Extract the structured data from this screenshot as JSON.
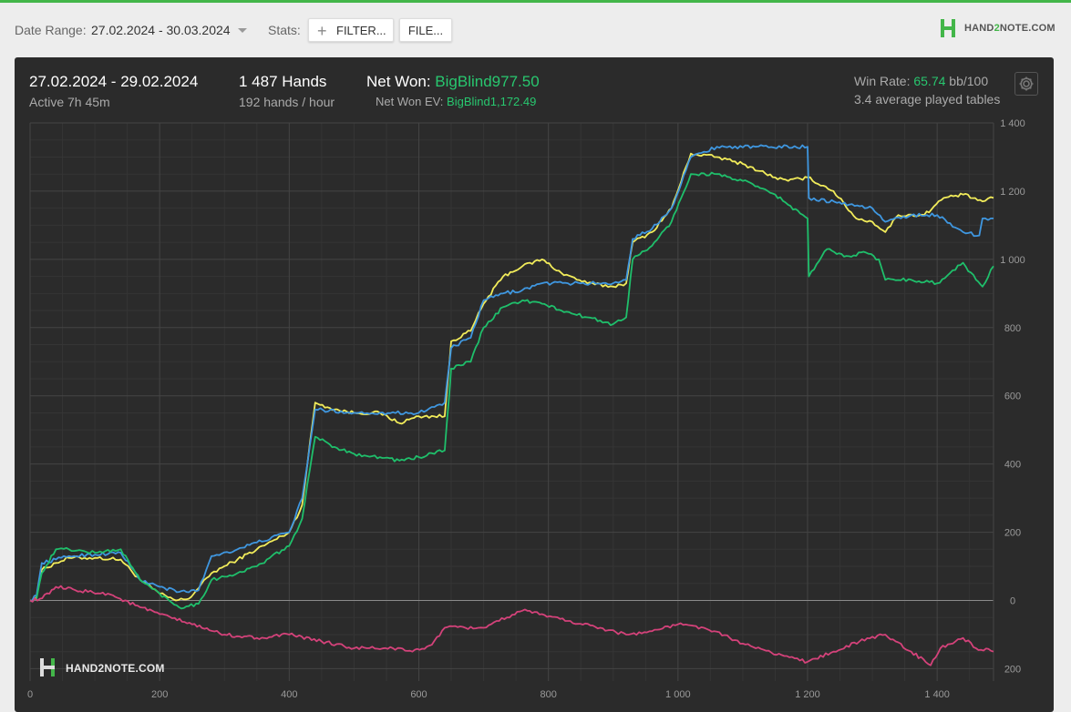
{
  "toolbar": {
    "date_range_label": "Date Range:",
    "date_range_value": "27.02.2024 - 30.03.2024",
    "stats_label": "Stats:",
    "filter_button": "FILTER...",
    "file_button": "FILE...",
    "brand": "HAND2NOTE.COM",
    "brand_parts": [
      "HAND",
      "2",
      "NOTE.COM"
    ]
  },
  "summary": {
    "date": "27.02.2024 - 29.02.2024",
    "active": "Active 7h 45m",
    "hands": "1 487 Hands",
    "hands_per_hour": "192 hands / hour",
    "net_won_label": "Net Won: ",
    "net_won_value": "BigBlind977.50",
    "net_won_ev_label": "Net Won  EV: ",
    "net_won_ev_value": "BigBlind1,172.49",
    "win_rate_label": "Win Rate: ",
    "win_rate_value": "65.74",
    "win_rate_unit": " bb/100",
    "avg_tables": "3.4 average played tables"
  },
  "watermark": "HAND2NOTE.COM",
  "colors": {
    "yellow": "#f2ec5a",
    "blue": "#3f97e0",
    "green": "#1fbf6b",
    "red": "#d4427a",
    "accent": "#28c76f"
  },
  "chart_data": {
    "type": "line",
    "xlim": [
      0,
      1487
    ],
    "ylim": [
      -220,
      1400
    ],
    "x_ticks": [
      0,
      200,
      400,
      600,
      800,
      1000,
      1200,
      1400
    ],
    "x_tick_labels": [
      "0",
      "200",
      "400",
      "600",
      "800",
      "1 000",
      "1 200",
      "1 400"
    ],
    "y_ticks": [
      -200,
      0,
      200,
      400,
      600,
      800,
      1000,
      1200,
      1400
    ],
    "y_tick_labels": [
      "200",
      "0",
      "200",
      "400",
      "600",
      "800",
      "1 000",
      "1 200",
      "1 400"
    ],
    "grid": true,
    "series": [
      {
        "color": "yellow",
        "points": [
          [
            0,
            0
          ],
          [
            10,
            10
          ],
          [
            18,
            90
          ],
          [
            40,
            110
          ],
          [
            60,
            125
          ],
          [
            100,
            125
          ],
          [
            140,
            120
          ],
          [
            170,
            60
          ],
          [
            200,
            20
          ],
          [
            225,
            0
          ],
          [
            245,
            5
          ],
          [
            280,
            80
          ],
          [
            320,
            120
          ],
          [
            350,
            150
          ],
          [
            400,
            200
          ],
          [
            420,
            280
          ],
          [
            440,
            580
          ],
          [
            470,
            560
          ],
          [
            500,
            550
          ],
          [
            540,
            550
          ],
          [
            570,
            520
          ],
          [
            600,
            540
          ],
          [
            640,
            540
          ],
          [
            650,
            760
          ],
          [
            680,
            790
          ],
          [
            700,
            870
          ],
          [
            730,
            950
          ],
          [
            760,
            980
          ],
          [
            790,
            1000
          ],
          [
            820,
            960
          ],
          [
            860,
            930
          ],
          [
            900,
            920
          ],
          [
            920,
            930
          ],
          [
            930,
            1050
          ],
          [
            960,
            1080
          ],
          [
            990,
            1150
          ],
          [
            1020,
            1310
          ],
          [
            1060,
            1300
          ],
          [
            1100,
            1280
          ],
          [
            1150,
            1240
          ],
          [
            1170,
            1230
          ],
          [
            1200,
            1240
          ],
          [
            1240,
            1200
          ],
          [
            1275,
            1120
          ],
          [
            1300,
            1110
          ],
          [
            1320,
            1080
          ],
          [
            1340,
            1130
          ],
          [
            1380,
            1130
          ],
          [
            1410,
            1180
          ],
          [
            1440,
            1190
          ],
          [
            1470,
            1170
          ],
          [
            1487,
            1180
          ]
        ]
      },
      {
        "color": "blue",
        "points": [
          [
            0,
            0
          ],
          [
            10,
            15
          ],
          [
            18,
            110
          ],
          [
            40,
            120
          ],
          [
            60,
            130
          ],
          [
            140,
            140
          ],
          [
            170,
            60
          ],
          [
            200,
            40
          ],
          [
            230,
            25
          ],
          [
            260,
            30
          ],
          [
            280,
            130
          ],
          [
            320,
            150
          ],
          [
            350,
            170
          ],
          [
            400,
            200
          ],
          [
            420,
            300
          ],
          [
            440,
            560
          ],
          [
            500,
            550
          ],
          [
            540,
            550
          ],
          [
            600,
            550
          ],
          [
            640,
            580
          ],
          [
            650,
            740
          ],
          [
            680,
            770
          ],
          [
            700,
            880
          ],
          [
            730,
            900
          ],
          [
            760,
            910
          ],
          [
            790,
            930
          ],
          [
            830,
            930
          ],
          [
            900,
            930
          ],
          [
            920,
            940
          ],
          [
            930,
            1060
          ],
          [
            960,
            1090
          ],
          [
            990,
            1150
          ],
          [
            1020,
            1300
          ],
          [
            1060,
            1330
          ],
          [
            1120,
            1330
          ],
          [
            1200,
            1330
          ],
          [
            1202,
            1180
          ],
          [
            1300,
            1150
          ],
          [
            1320,
            1110
          ],
          [
            1360,
            1130
          ],
          [
            1400,
            1130
          ],
          [
            1440,
            1080
          ],
          [
            1465,
            1070
          ],
          [
            1470,
            1120
          ],
          [
            1487,
            1120
          ]
        ]
      },
      {
        "color": "green",
        "points": [
          [
            0,
            0
          ],
          [
            10,
            5
          ],
          [
            18,
            80
          ],
          [
            40,
            150
          ],
          [
            60,
            150
          ],
          [
            100,
            140
          ],
          [
            140,
            150
          ],
          [
            170,
            60
          ],
          [
            200,
            20
          ],
          [
            230,
            -20
          ],
          [
            260,
            -10
          ],
          [
            280,
            60
          ],
          [
            320,
            80
          ],
          [
            350,
            100
          ],
          [
            400,
            160
          ],
          [
            420,
            240
          ],
          [
            440,
            480
          ],
          [
            470,
            450
          ],
          [
            500,
            430
          ],
          [
            540,
            420
          ],
          [
            570,
            410
          ],
          [
            600,
            420
          ],
          [
            640,
            440
          ],
          [
            650,
            680
          ],
          [
            680,
            700
          ],
          [
            700,
            800
          ],
          [
            730,
            860
          ],
          [
            760,
            880
          ],
          [
            790,
            870
          ],
          [
            820,
            850
          ],
          [
            860,
            830
          ],
          [
            900,
            810
          ],
          [
            920,
            830
          ],
          [
            930,
            1000
          ],
          [
            960,
            1040
          ],
          [
            990,
            1110
          ],
          [
            1020,
            1250
          ],
          [
            1060,
            1250
          ],
          [
            1100,
            1230
          ],
          [
            1150,
            1190
          ],
          [
            1170,
            1160
          ],
          [
            1200,
            1120
          ],
          [
            1202,
            950
          ],
          [
            1230,
            1030
          ],
          [
            1260,
            1010
          ],
          [
            1290,
            1020
          ],
          [
            1310,
            1000
          ],
          [
            1320,
            940
          ],
          [
            1360,
            940
          ],
          [
            1400,
            930
          ],
          [
            1420,
            960
          ],
          [
            1440,
            990
          ],
          [
            1460,
            940
          ],
          [
            1470,
            920
          ],
          [
            1487,
            980
          ]
        ]
      },
      {
        "color": "red",
        "points": [
          [
            0,
            0
          ],
          [
            15,
            5
          ],
          [
            30,
            20
          ],
          [
            40,
            40
          ],
          [
            70,
            30
          ],
          [
            120,
            20
          ],
          [
            170,
            -20
          ],
          [
            200,
            -40
          ],
          [
            250,
            -70
          ],
          [
            300,
            -100
          ],
          [
            350,
            -110
          ],
          [
            400,
            -100
          ],
          [
            450,
            -120
          ],
          [
            500,
            -140
          ],
          [
            560,
            -140
          ],
          [
            590,
            -150
          ],
          [
            620,
            -130
          ],
          [
            640,
            -80
          ],
          [
            700,
            -80
          ],
          [
            720,
            -60
          ],
          [
            740,
            -50
          ],
          [
            760,
            -30
          ],
          [
            790,
            -40
          ],
          [
            830,
            -60
          ],
          [
            880,
            -80
          ],
          [
            920,
            -100
          ],
          [
            960,
            -90
          ],
          [
            1000,
            -70
          ],
          [
            1040,
            -80
          ],
          [
            1080,
            -110
          ],
          [
            1120,
            -140
          ],
          [
            1160,
            -160
          ],
          [
            1200,
            -180
          ],
          [
            1240,
            -150
          ],
          [
            1280,
            -120
          ],
          [
            1320,
            -100
          ],
          [
            1360,
            -150
          ],
          [
            1390,
            -190
          ],
          [
            1405,
            -140
          ],
          [
            1440,
            -110
          ],
          [
            1460,
            -140
          ],
          [
            1487,
            -150
          ]
        ]
      }
    ]
  }
}
